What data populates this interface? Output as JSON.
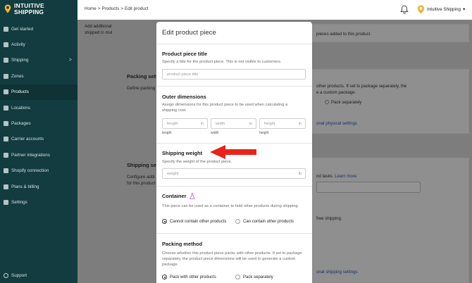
{
  "brand": {
    "line1": "INTUITIVE",
    "line2": "SHIPPING"
  },
  "nav": {
    "items": [
      {
        "label": "Get started",
        "icon": "rocket-icon"
      },
      {
        "label": "Activity",
        "icon": "activity-icon"
      },
      {
        "label": "Shipping",
        "icon": "truck-icon",
        "chevron": ">"
      },
      {
        "label": "Zones",
        "icon": "zones-icon"
      },
      {
        "label": "Products",
        "icon": "products-icon"
      },
      {
        "label": "Locations",
        "icon": "location-icon"
      },
      {
        "label": "Packages",
        "icon": "package-icon"
      },
      {
        "label": "Carrier accounts",
        "icon": "key-icon"
      },
      {
        "label": "Partner integrations",
        "icon": "integration-icon"
      },
      {
        "label": "Shopify connection",
        "icon": "shopify-icon"
      },
      {
        "label": "Plans & billing",
        "icon": "billing-icon"
      },
      {
        "label": "Settings",
        "icon": "gear-icon"
      }
    ],
    "support": "Support"
  },
  "topbar": {
    "breadcrumb": [
      "Home",
      ">",
      "Products",
      ">",
      "Edit product"
    ],
    "account": "Intuitive Shipping",
    "account_caret": "▾"
  },
  "background": {
    "add_text_1": "Add additional",
    "add_text_2": "shipped in mul",
    "pieces_added": "pieces added to this product.",
    "packing_title": "Packing sett",
    "packing_desc": "Define packing",
    "pack_separately_1": "other products. If set to package separately, the",
    "pack_separately_2": "e a custom package.",
    "pack_separately_radio": "Pack separately",
    "physical_settings": "onal physical settings",
    "shipping_title": "Shipping set",
    "shipping_desc_1": "Configure addi",
    "shipping_desc_2": "for this product",
    "tasks": "nd tasks.",
    "learn_more": "Learn more",
    "free_shipping": "free shipping.",
    "shipping_settings": "onal shipping settings"
  },
  "modal": {
    "title": "Edit product piece",
    "piece_title": {
      "heading": "Product piece title",
      "desc": "Specify a title for the product piece. This is not visible to customers.",
      "placeholder": "product piece title"
    },
    "outer_dimensions": {
      "heading": "Outer dimensions",
      "desc": "Assign dimensions for this product piece to be used when calculating a shipping cost.",
      "fields": [
        {
          "placeholder": "length",
          "unit": "in",
          "label": "length"
        },
        {
          "placeholder": "width",
          "unit": "in",
          "label": "width"
        },
        {
          "placeholder": "height",
          "unit": "in",
          "label": "height"
        }
      ]
    },
    "shipping_weight": {
      "heading": "Shipping weight",
      "desc": "Specify the weight of the product piece.",
      "placeholder": "weight",
      "unit": "lb"
    },
    "container": {
      "heading": "Container",
      "icon": "flask-icon",
      "desc": "This piece can be used as a container to hold other products during shipping.",
      "options": [
        "Cannot contain other products",
        "Can contain other products"
      ],
      "selected": 0
    },
    "packing_method": {
      "heading": "Packing method",
      "desc": "Choose whether this product piece packs with other products. If set to package separately, the product piece dimensions will be used to generate a custom package.",
      "options": [
        "Pack with other products",
        "Pack separately"
      ],
      "selected": 0
    }
  },
  "colors": {
    "sidebar": "#123c3f",
    "annotation_arrow": "#e8231a",
    "container_icon": "#b05bc9"
  }
}
